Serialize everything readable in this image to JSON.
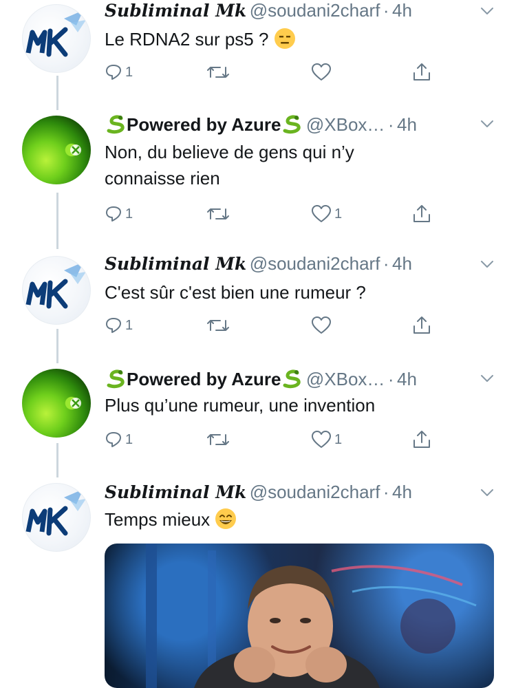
{
  "tweets": [
    {
      "author": "Subliminal Mk",
      "handle": "@soudani2charf",
      "dot": "·",
      "time": "4h",
      "text": "Le RDNA2 sur ps5 ?",
      "emoji": "expressionless-face",
      "replies": "1",
      "retweets": "",
      "likes": ""
    },
    {
      "author": "Powered by Azure",
      "handle": "@XBox…",
      "dot": "·",
      "time": "4h",
      "text": "Non, du believe de gens qui n’y connaisse rien",
      "replies": "1",
      "retweets": "",
      "likes": "1"
    },
    {
      "author": "Subliminal Mk",
      "handle": "@soudani2charf",
      "dot": "·",
      "time": "4h",
      "text": "C'est sûr c'est bien une rumeur ?",
      "replies": "1",
      "retweets": "",
      "likes": ""
    },
    {
      "author": "Powered by Azure",
      "handle": "@XBox…",
      "dot": "·",
      "time": "4h",
      "text": "Plus qu’une rumeur, une invention",
      "replies": "1",
      "retweets": "",
      "likes": "1"
    },
    {
      "author": "Subliminal Mk",
      "handle": "@soudani2charf",
      "dot": "·",
      "time": "4h",
      "text": "Temps mieux",
      "emoji": "grinning-face-with-smiling-eyes"
    }
  ],
  "avatars": {
    "mk_text": "MK"
  },
  "colors": {
    "text": "#14171a",
    "secondary": "#657786",
    "thread_line": "#ccd6dd",
    "icon": "#657786"
  }
}
